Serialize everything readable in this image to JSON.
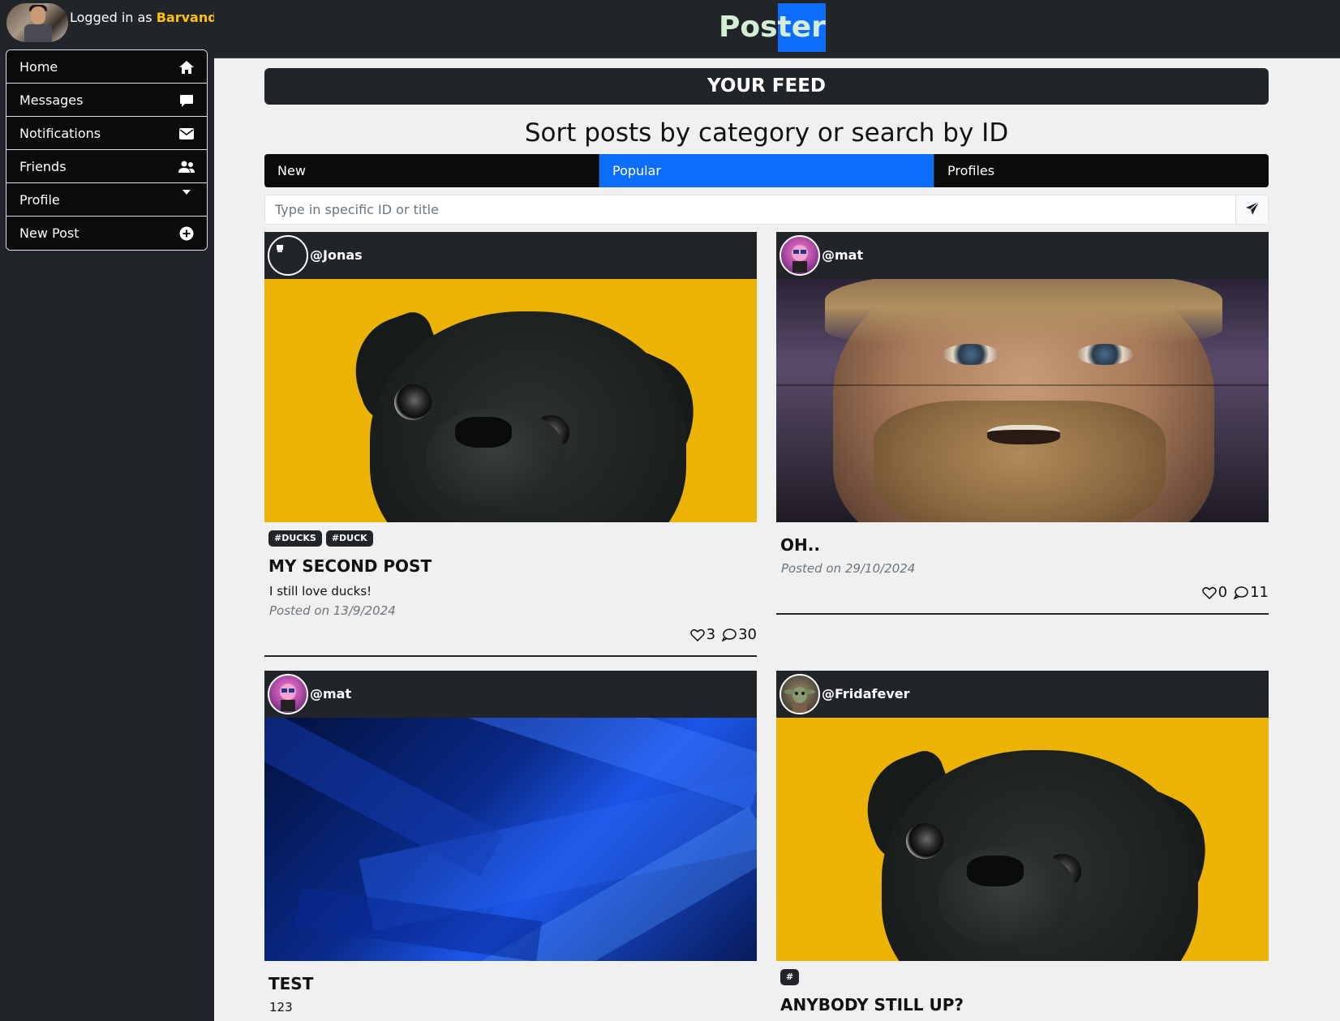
{
  "user": {
    "logged_prefix": "Logged in as ",
    "username": "Barvandy"
  },
  "nav": [
    {
      "label": "Home",
      "icon": "home-icon"
    },
    {
      "label": "Messages",
      "icon": "chat-icon"
    },
    {
      "label": "Notifications",
      "icon": "envelope-icon"
    },
    {
      "label": "Friends",
      "icon": "people-icon"
    },
    {
      "label": "Profile",
      "icon": "caret-down-icon"
    },
    {
      "label": "New Post",
      "icon": "plus-circle-icon"
    }
  ],
  "brand": {
    "left": "Pos",
    "highlight": "ter"
  },
  "feed": {
    "banner": "YOUR FEED",
    "sort_title": "Sort posts by category or search by ID",
    "tabs": [
      "New",
      "Popular",
      "Profiles"
    ],
    "active_tab": "Popular",
    "search_placeholder": "Type in specific ID or title"
  },
  "posts": [
    {
      "user": "@Jonas",
      "tags": [
        "#DUCKS",
        "#DUCK"
      ],
      "title": "MY SECOND POST",
      "desc": "I still love ducks!",
      "date": "Posted on 13/9/2024",
      "likes": "3",
      "comments": "30",
      "image": "pug"
    },
    {
      "user": "@mat",
      "tags": [],
      "title": "OH..",
      "desc": "",
      "date": "Posted on 29/10/2024",
      "likes": "0",
      "comments": "11",
      "image": "kenobi"
    },
    {
      "user": "@mat",
      "tags": [],
      "title": "TEST",
      "desc": "123",
      "image": "blue-abstract"
    },
    {
      "user": "@Fridafever",
      "tags": [
        "#"
      ],
      "title": "ANYBODY STILL UP?",
      "image": "pug"
    }
  ],
  "colors": {
    "accent": "#0d6efd",
    "dark": "#212529",
    "username": "#ffc107",
    "pug_bg": "#ecb304"
  }
}
